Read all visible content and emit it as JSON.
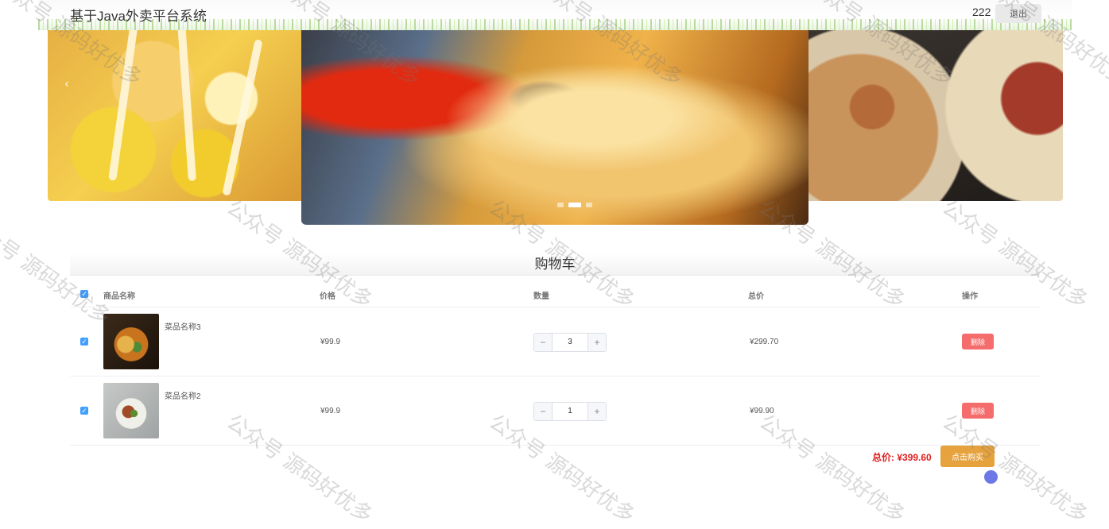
{
  "header": {
    "title": "基于Java外卖平台系统",
    "username": "222",
    "logout_label": "退出"
  },
  "carousel": {
    "prev_icon": "chevron-left-icon",
    "prev_glyph": "‹",
    "dot_count": 3,
    "active_index": 1
  },
  "cart": {
    "title": "购物车",
    "columns": [
      "商品名称",
      "价格",
      "数量",
      "总价",
      "操作"
    ],
    "items": [
      {
        "name": "菜品名称3",
        "price": "¥99.9",
        "quantity": "3",
        "total": "¥299.70",
        "delete_label": "删除",
        "checked": true
      },
      {
        "name": "菜品名称2",
        "price": "¥99.9",
        "quantity": "1",
        "total": "¥99.90",
        "delete_label": "删除",
        "checked": true
      }
    ],
    "stepper_minus": "−",
    "stepper_plus": "+",
    "check_glyph": "✓",
    "total_label": "总价:",
    "total_value": "¥399.60",
    "buy_label": "点击购买"
  },
  "watermark": {
    "text": "公众号 源码好优多"
  },
  "colors": {
    "primary": "#409eff",
    "danger": "#f56c6c",
    "warning": "#e6a23c",
    "total_red": "#e02020"
  }
}
